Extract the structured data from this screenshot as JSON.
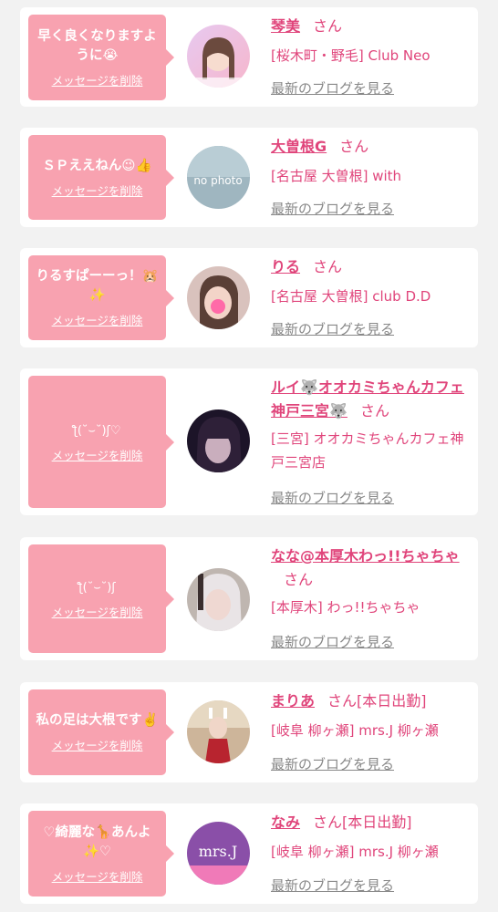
{
  "cards": [
    {
      "message": "早く良くなりますように😭",
      "delete_label": "メッセージを削除",
      "name": "琴美",
      "honorific": "さん",
      "shop": "[桜木町・野毛] Club Neo",
      "blog_link": "最新のブログを見る"
    },
    {
      "message": "ＳＰええねん😉👍",
      "delete_label": "メッセージを削除",
      "name": "大曽根G",
      "honorific": "さん",
      "shop": "[名古屋 大曽根] with",
      "avatar_text": "no photo",
      "blog_link": "最新のブログを見る"
    },
    {
      "message": "りるすぱーーっ！🐹✨",
      "delete_label": "メッセージを削除",
      "name": "りる",
      "honorific": "さん",
      "shop": "[名古屋 大曽根] club D.D",
      "blog_link": "最新のブログを見る"
    },
    {
      "message": "ƪ(˘⌣˘)ʃ♡",
      "delete_label": "メッセージを削除",
      "name": "ルイ🐺オオカミちゃんカフェ神戸三宮🐺",
      "honorific": "さん",
      "shop": "[三宮] オオカミちゃんカフェ神戸三宮店",
      "blog_link": "最新のブログを見る"
    },
    {
      "message": "ƪ(˘⌣˘)ʃ",
      "delete_label": "メッセージを削除",
      "name": "なな@本厚木わっ!!ちゃちゃ",
      "honorific": "さん",
      "shop": "[本厚木] わっ!!ちゃちゃ",
      "blog_link": "最新のブログを見る"
    },
    {
      "message": "私の足は大根です✌️",
      "delete_label": "メッセージを削除",
      "name": "まりあ",
      "honorific": "さん[本日出勤]",
      "shop": "[岐阜 柳ヶ瀬] mrs.J 柳ヶ瀬",
      "blog_link": "最新のブログを見る"
    },
    {
      "message": "♡綺麗な🦒あんよ✨♡",
      "delete_label": "メッセージを削除",
      "name": "なみ",
      "honorific": "さん[本日出勤]",
      "shop": "[岐阜 柳ヶ瀬] mrs.J 柳ヶ瀬",
      "avatar_text": "mrs.J",
      "blog_link": "最新のブログを見る"
    }
  ],
  "colors": {
    "accent": "#e0457b",
    "bubble": "#f8a2b0",
    "link_gray": "#888888",
    "background": "#f2f2f2"
  }
}
